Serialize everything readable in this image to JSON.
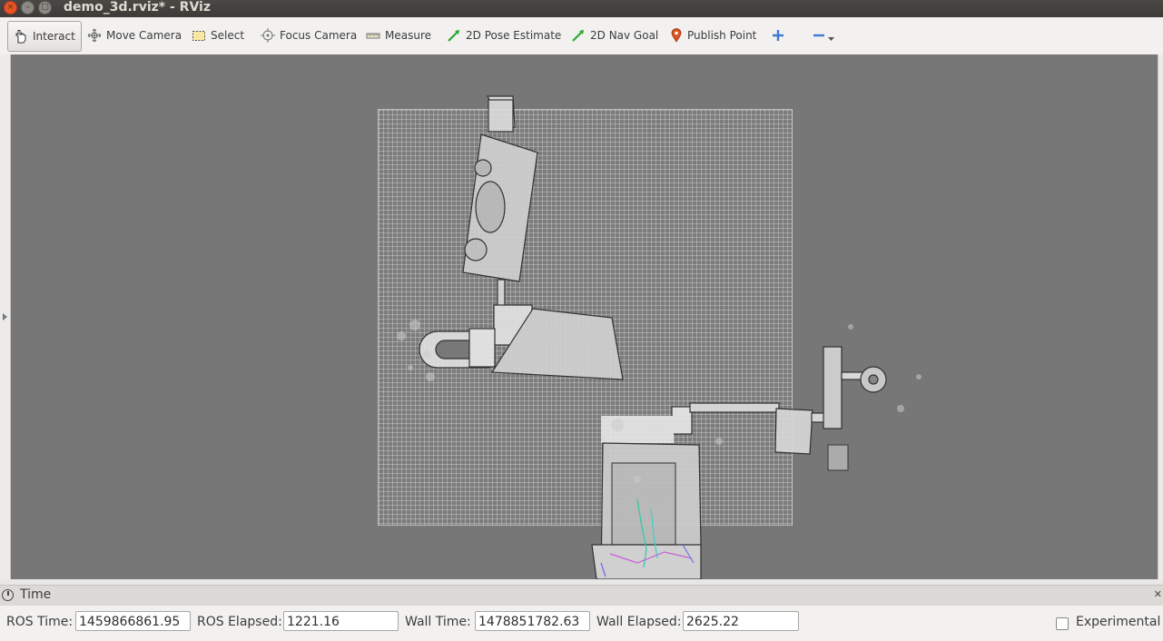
{
  "window": {
    "title": "demo_3d.rviz* - RViz",
    "controls": {
      "close": "×",
      "minimize": "–",
      "maximize": "▢"
    }
  },
  "toolbar": {
    "tools": [
      {
        "label": "Interact",
        "icon": "hand-pointer-icon",
        "active": true
      },
      {
        "label": "Move Camera",
        "icon": "move-camera-icon"
      },
      {
        "label": "Select",
        "icon": "select-box-icon"
      },
      {
        "label": "Focus Camera",
        "icon": "focus-target-icon"
      },
      {
        "label": "Measure",
        "icon": "ruler-icon"
      },
      {
        "label": "2D Pose Estimate",
        "icon": "green-arrow-icon"
      },
      {
        "label": "2D Nav Goal",
        "icon": "green-arrow-icon"
      },
      {
        "label": "Publish Point",
        "icon": "map-pin-icon"
      }
    ],
    "add_icon": "plus-icon",
    "remove_icon": "minus-icon",
    "dropdown_icon": "chevron-down-icon"
  },
  "time_panel": {
    "title": "Time",
    "ros_time_label": "ROS Time:",
    "ros_time_value": "1459866861.95",
    "ros_elapsed_label": "ROS Elapsed:",
    "ros_elapsed_value": "1221.16",
    "wall_time_label": "Wall Time:",
    "wall_time_value": "1478851782.63",
    "wall_elapsed_label": "Wall Elapsed:",
    "wall_elapsed_value": "2625.22",
    "experimental_label": "Experimental",
    "experimental_checked": false
  },
  "colors": {
    "viewport_bg": "#777777",
    "grid": "#e6e6e6",
    "nav_green": "#2fa52f",
    "pin_orange": "#d9531e",
    "accent_blue": "#3b7bd4"
  }
}
